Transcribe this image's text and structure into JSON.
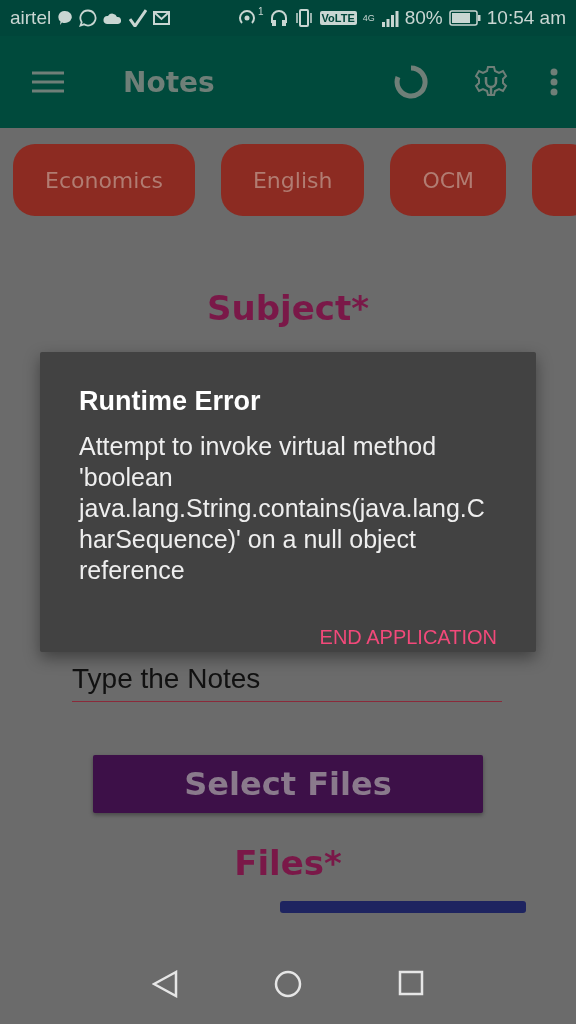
{
  "status_bar": {
    "carrier": "airtel",
    "hotspot_count": "1",
    "volte": "VoLTE",
    "network": "4G",
    "battery_text": "80%",
    "time": "10:54 am"
  },
  "app_bar": {
    "title": "Notes"
  },
  "chips": [
    {
      "kind": "label",
      "label": "Economics"
    },
    {
      "kind": "label",
      "label": "English"
    },
    {
      "kind": "label",
      "label": "OCM"
    },
    {
      "kind": "partial"
    }
  ],
  "subject_heading": "Subject*",
  "notes_field": {
    "placeholder": "Type the Notes"
  },
  "select_button": "Select Files",
  "files_heading": "Files*",
  "dialog": {
    "title": "Runtime Error",
    "message": "Attempt to invoke virtual method 'boolean java.lang.String.contains(java.lang.CharSequence)' on a null object reference",
    "button": "END APPLICATION"
  }
}
